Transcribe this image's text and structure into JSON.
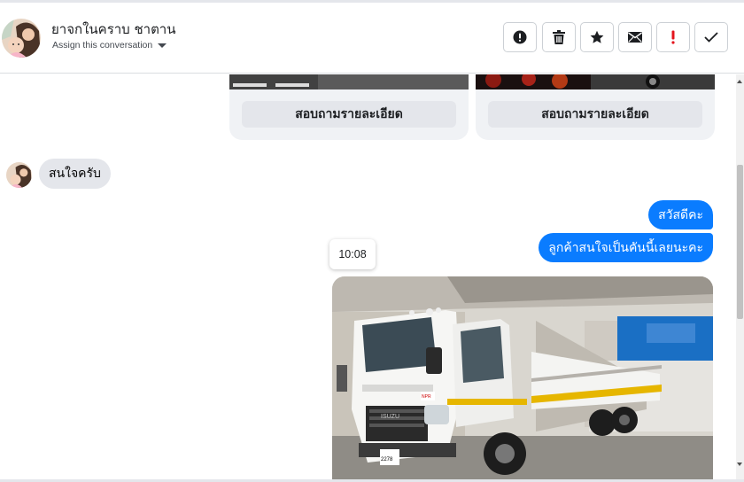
{
  "header": {
    "contact_name": "ยาจกในคราบ ชาตาน",
    "assign_label": "Assign this conversation"
  },
  "toolbar": {
    "buttons": [
      {
        "name": "mark-spam",
        "icon": "exclamation-circle-icon"
      },
      {
        "name": "delete",
        "icon": "trash-icon"
      },
      {
        "name": "star",
        "icon": "star-icon"
      },
      {
        "name": "mark-unread",
        "icon": "envelope-icon"
      },
      {
        "name": "follow-up",
        "icon": "red-exclamation-icon"
      },
      {
        "name": "mark-done",
        "icon": "checkmark-icon"
      }
    ]
  },
  "chat": {
    "cards": [
      {
        "button_label": "สอบถามรายละเอียด"
      },
      {
        "button_label": "สอบถามรายละเอียด"
      }
    ],
    "incoming_message": "สนใจครับ",
    "outgoing_messages": [
      "สวัสดีคะ",
      "ลูกค้าสนใจเป็นคันนี้เลยนะคะ"
    ],
    "timestamp": "10:08",
    "photo": {
      "subject": "white Isuzu NPR light truck with flatbed",
      "badge": "NPR",
      "plate": "ผย 2278"
    }
  },
  "colors": {
    "outgoing_bubble": "#0a7cff",
    "incoming_bubble": "#e4e6eb",
    "follow_up_red": "#e4141c"
  }
}
